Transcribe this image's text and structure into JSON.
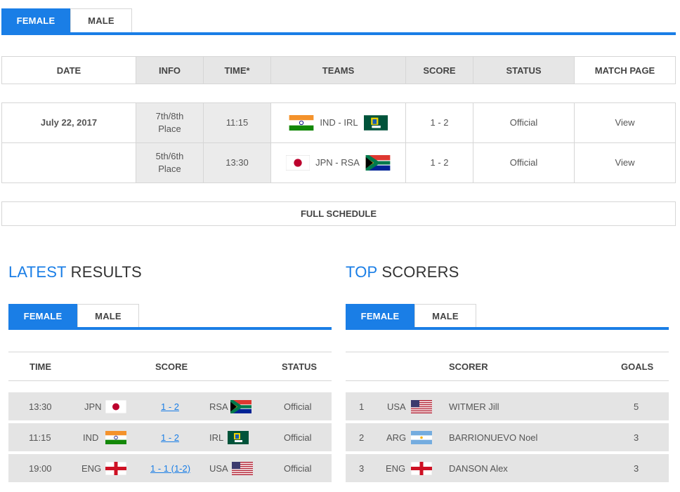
{
  "top_tabs": {
    "female": "FEMALE",
    "male": "MALE"
  },
  "schedule": {
    "headers": {
      "date": "DATE",
      "info": "INFO",
      "time": "TIME*",
      "teams": "TEAMS",
      "score": "SCORE",
      "status": "STATUS",
      "match_page": "MATCH PAGE"
    },
    "rows": [
      {
        "date": "July 22, 2017",
        "info_line1": "7th/8th",
        "info_line2": "Place",
        "time": "11:15",
        "teams": "IND - IRL",
        "score": "1 - 2",
        "status": "Official",
        "link": "View"
      },
      {
        "date": "",
        "info_line1": "5th/6th",
        "info_line2": "Place",
        "time": "13:30",
        "teams": "JPN - RSA",
        "score": "1 - 2",
        "status": "Official",
        "link": "View"
      }
    ],
    "full_schedule": "FULL SCHEDULE"
  },
  "latest": {
    "title_accent": "LATEST",
    "title_rest": "RESULTS",
    "tabs": {
      "female": "FEMALE",
      "male": "MALE"
    },
    "headers": {
      "time": "TIME",
      "score": "SCORE",
      "status": "STATUS"
    },
    "rows": [
      {
        "time": "13:30",
        "home": "JPN",
        "score": "1 - 2",
        "away": "RSA",
        "status": "Official"
      },
      {
        "time": "11:15",
        "home": "IND",
        "score": "1 - 2",
        "away": "IRL",
        "status": "Official"
      },
      {
        "time": "19:00",
        "home": "ENG",
        "score": "1 - 1 (1-2)",
        "away": "USA",
        "status": "Official"
      }
    ]
  },
  "scorers": {
    "title_accent": "TOP",
    "title_rest": "SCORERS",
    "tabs": {
      "female": "FEMALE",
      "male": "MALE"
    },
    "headers": {
      "scorer": "SCORER",
      "goals": "GOALS"
    },
    "rows": [
      {
        "rank": "1",
        "country": "USA",
        "name": "WITMER Jill",
        "goals": "5"
      },
      {
        "rank": "2",
        "country": "ARG",
        "name": "BARRIONUEVO Noel",
        "goals": "3"
      },
      {
        "rank": "3",
        "country": "ENG",
        "name": "DANSON Alex",
        "goals": "3"
      }
    ]
  },
  "colors": {
    "accent": "#1a7ee6",
    "row_shade": "#e4e4e4"
  }
}
